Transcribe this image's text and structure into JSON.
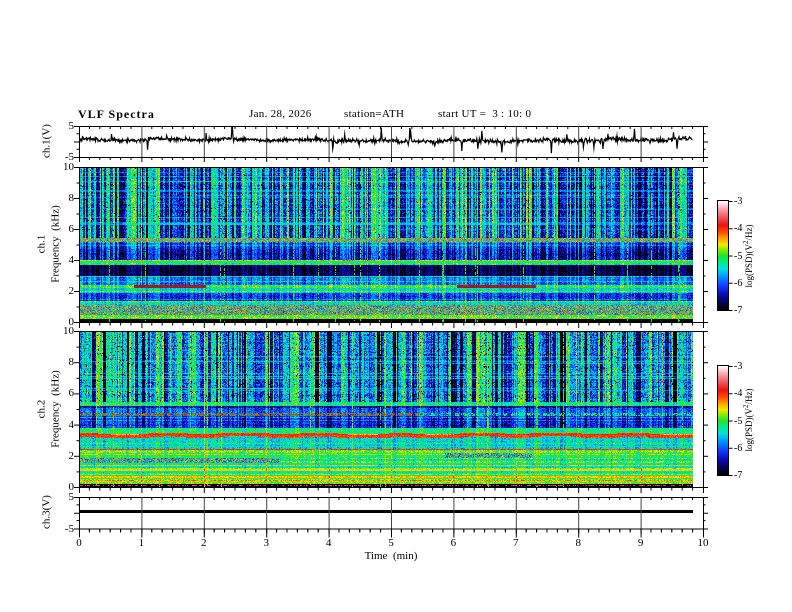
{
  "header": {
    "title": "VLF Spectra",
    "date": "Jan. 28, 2026",
    "station": "station=ATH",
    "start_ut": "start UT =  3 : 10: 0"
  },
  "x_axis": {
    "label": "Time  (min)",
    "range_min": [
      0,
      10
    ],
    "tick_labels": [
      "0",
      "1",
      "2",
      "3",
      "4",
      "5",
      "6",
      "7",
      "8",
      "9",
      "10"
    ],
    "minor_ticks_per_major": 6,
    "data_end_min": 9.82
  },
  "colorbar": {
    "label_prefix": "log(PSD)(V",
    "label_sup": "2",
    "label_suffix": "/Hz)",
    "tick_labels": [
      "-3",
      "-4",
      "-5",
      "-6",
      "-7"
    ],
    "range": [
      -7,
      -3
    ],
    "colormap_stops": [
      [
        0.0,
        0,
        0,
        0
      ],
      [
        0.07,
        5,
        5,
        90
      ],
      [
        0.14,
        10,
        10,
        180
      ],
      [
        0.22,
        20,
        60,
        255
      ],
      [
        0.3,
        0,
        145,
        255
      ],
      [
        0.38,
        0,
        225,
        225
      ],
      [
        0.44,
        0,
        235,
        140
      ],
      [
        0.5,
        40,
        225,
        40
      ],
      [
        0.56,
        150,
        235,
        0
      ],
      [
        0.6,
        248,
        230,
        0
      ],
      [
        0.66,
        255,
        160,
        0
      ],
      [
        0.72,
        255,
        70,
        0
      ],
      [
        0.78,
        232,
        20,
        20
      ],
      [
        0.88,
        245,
        110,
        120
      ],
      [
        0.94,
        250,
        175,
        185
      ],
      [
        1.0,
        255,
        250,
        250
      ]
    ]
  },
  "chart_data": [
    {
      "type": "line",
      "panel": "ch1-voltage",
      "ylabel": "ch.1(V)",
      "ylim": [
        -5,
        5
      ],
      "ytick_labels": [
        "5",
        "-5"
      ],
      "ytick_values": [
        5,
        -5
      ],
      "seed": 101,
      "mean": 0.4,
      "noise_sigma": 0.3,
      "spike_count": 48,
      "spike_max": 3.8
    },
    {
      "type": "heatmap",
      "panel": "ch1-spectrogram",
      "ylabel1": "ch.1",
      "ylabel2": "Frequency  (kHz)",
      "ylim": [
        0,
        10
      ],
      "ytick_labels": [
        "10",
        "8",
        "6",
        "4",
        "2",
        "0"
      ],
      "ytick_values": [
        10,
        8,
        6,
        4,
        2,
        0
      ],
      "clim": [
        -7,
        -3
      ],
      "seed": 7,
      "lam": {
        "fmax": 5.4,
        "p": 0.13,
        "min": 0.25,
        "max": 0.55
      },
      "stripe": {
        "neg": 0.5,
        "pos": 1.3,
        "wmax": 2,
        "p0": 0.22,
        "pneg": 0.3,
        "strong": 18,
        "env": 0.12
      },
      "bands": [
        {
          "lo": 0.0,
          "hi": 0.15,
          "v": -7.0,
          "n": 0.05,
          "sw": 0.0
        },
        {
          "lo": 0.15,
          "hi": 0.45,
          "v": -5.0,
          "n": 0.36,
          "sw": 0.15,
          "hot": 0.06
        },
        {
          "lo": 0.45,
          "hi": 1.05,
          "kind": "uniform",
          "a": -6.4,
          "b": -3.9,
          "sw": 0.0
        },
        {
          "lo": 1.05,
          "hi": 1.3,
          "v": -5.55,
          "n": 0.3,
          "sw": 0.25
        },
        {
          "lo": 1.3,
          "hi": 1.85,
          "v": -6.3,
          "n": 0.3,
          "sw": 0.3
        },
        {
          "lo": 1.85,
          "hi": 2.15,
          "v": -5.55,
          "n": 0.25,
          "sw": 0.25
        },
        {
          "lo": 2.15,
          "hi": 2.4,
          "v": -5.1,
          "n": 0.3,
          "sw": 0.25
        },
        {
          "lo": 2.4,
          "hi": 2.95,
          "v": -6.05,
          "n": 0.3,
          "sw": 0.35
        },
        {
          "lo": 2.95,
          "hi": 3.7,
          "v": -6.85,
          "n": 0.2,
          "sw": 0.28
        },
        {
          "lo": 3.7,
          "hi": 4.0,
          "v": -5.35,
          "n": 0.35,
          "sw": 0.35
        },
        {
          "lo": 4.0,
          "hi": 4.7,
          "v": -6.55,
          "n": 0.3,
          "sw": 0.55
        },
        {
          "lo": 4.7,
          "hi": 5.15,
          "v": -6.3,
          "n": 0.3,
          "sw": 0.55
        },
        {
          "lo": 5.15,
          "hi": 5.4,
          "kind": "uniform",
          "a": -6.1,
          "b": -3.8,
          "sw": 0.0
        },
        {
          "lo": 5.4,
          "hi": 10.01,
          "v": -6.25,
          "n": 0.45,
          "sw": 1.0,
          "rn": 0.15,
          "dk": 0.02
        }
      ],
      "features": [
        {
          "type": "hline",
          "f": 2.28,
          "hw": 0.1,
          "v": -3.9,
          "n": 0.25,
          "t0": 0.88,
          "t1": 2.02,
          "avg": 2,
          "dark": 1
        },
        {
          "type": "hline",
          "f": 2.28,
          "hw": 0.1,
          "v": -3.9,
          "n": 0.25,
          "t0": 6.05,
          "t1": 7.32,
          "avg": 2,
          "dark": 1
        },
        {
          "type": "hline",
          "f": 3.86,
          "hw": 0.08,
          "v": -5.15,
          "n": 0.25,
          "t0": 0,
          "t1": 9.82
        },
        {
          "type": "hlines_random",
          "count": 13,
          "fmin": 5.6,
          "fmax": 9.9,
          "v": -5.5,
          "n": 0.2
        },
        {
          "type": "vlines",
          "count": 22,
          "v": -5.05,
          "mix": 0.7
        },
        {
          "type": "hotpixels",
          "fmin": 9.4,
          "fmax": 10.0,
          "p": 0.002,
          "v": -4.2
        }
      ]
    },
    {
      "type": "heatmap",
      "panel": "ch2-spectrogram",
      "ylabel1": "ch.2",
      "ylabel2": "Frequency  (kHz)",
      "ylim": [
        0,
        10
      ],
      "ytick_labels": [
        "10",
        "8",
        "6",
        "4",
        "2",
        "0"
      ],
      "ytick_values": [
        10,
        8,
        6,
        4,
        2,
        0
      ],
      "clim": [
        -7,
        -3
      ],
      "seed": 23,
      "lam": {
        "fmax": 4.55,
        "p": 0.22,
        "min": 0.3,
        "max": 0.85
      },
      "stripe": {
        "neg": 1.45,
        "pos": 0.55,
        "wmax": 4,
        "p0": 0.22,
        "pneg": 0.6,
        "strong": 10,
        "env": 0.1
      },
      "bands": [
        {
          "lo": 0.0,
          "hi": 0.15,
          "v": -7.0,
          "n": 0.05,
          "sw": 0.0
        },
        {
          "lo": 0.15,
          "hi": 0.5,
          "v": -4.8,
          "n": 0.32,
          "sw": 0.1,
          "hot": 0.03
        },
        {
          "lo": 0.5,
          "hi": 0.9,
          "v": -5.1,
          "n": 0.3,
          "sw": 0.12
        },
        {
          "lo": 0.9,
          "hi": 1.5,
          "v": -5.35,
          "n": 0.28,
          "sw": 0.15
        },
        {
          "lo": 1.5,
          "hi": 1.85,
          "v": -5.35,
          "n": 0.28,
          "sw": 0.15
        },
        {
          "lo": 1.85,
          "hi": 2.15,
          "v": -5.1,
          "n": 0.3,
          "sw": 0.15
        },
        {
          "lo": 2.15,
          "hi": 2.45,
          "v": -4.75,
          "n": 0.28,
          "sw": 0.15
        },
        {
          "lo": 2.45,
          "hi": 3.15,
          "v": -5.45,
          "n": 0.32,
          "sw": 0.2
        },
        {
          "lo": 3.15,
          "hi": 3.42,
          "v": -4.0,
          "n": 0.18,
          "sw": 0.0,
          "wavy": 1
        },
        {
          "lo": 3.42,
          "hi": 3.75,
          "v": -5.15,
          "n": 0.28,
          "sw": 0.2
        },
        {
          "lo": 3.75,
          "hi": 4.55,
          "v": -6.15,
          "n": 0.32,
          "sw": 0.45
        },
        {
          "lo": 4.55,
          "hi": 5.05,
          "v": -5.9,
          "n": 0.32,
          "sw": 0.4
        },
        {
          "lo": 5.05,
          "hi": 5.2,
          "v": -6.45,
          "n": 0.35,
          "sw": 0.25
        },
        {
          "lo": 5.2,
          "hi": 5.45,
          "v": -5.15,
          "n": 0.28,
          "sw": 0.3
        },
        {
          "lo": 5.45,
          "hi": 10.01,
          "v": -5.6,
          "n": 0.48,
          "sw": 1.0,
          "rn": 0.14,
          "dk": 0.05
        }
      ],
      "features": [
        {
          "type": "grayseg",
          "f0": 1.5,
          "f1": 1.85,
          "t0": 0,
          "t1": 3.2,
          "a": -6.6,
          "b": -4.1
        },
        {
          "type": "grayseg",
          "f0": 1.85,
          "f1": 2.15,
          "t0": 5.85,
          "t1": 7.25,
          "a": -6.6,
          "b": -4.3
        },
        {
          "type": "hline",
          "f": 0.62,
          "hw": 0.07,
          "v": -4.45,
          "n": 0.2,
          "t0": 0,
          "t1": 9.82
        },
        {
          "type": "hline",
          "f": 1.05,
          "hw": 0.06,
          "v": -4.6,
          "n": 0.2,
          "t0": 0,
          "t1": 9.82
        },
        {
          "type": "dotline",
          "f": 4.65,
          "hw": 0.09,
          "v": -4.35,
          "n": 0.3,
          "t0": 0,
          "t1": 5.5,
          "duty": 0.55,
          "avg": 2,
          "dark": 1
        },
        {
          "type": "dotline",
          "f": 4.65,
          "hw": 0.07,
          "v": -5.1,
          "n": 0.3,
          "t0": 5.5,
          "t1": 9.82,
          "duty": 0.35
        },
        {
          "type": "dotline",
          "f": 0.06,
          "hw": 0.05,
          "v": -4.05,
          "n": 0.2,
          "t0": 0,
          "t1": 9.82,
          "duty": 0.45
        },
        {
          "type": "hlines_random",
          "count": 9,
          "fmin": 5.6,
          "fmax": 9.9,
          "v": -5.3,
          "n": 0.2
        },
        {
          "type": "vlines",
          "count": 20,
          "v": -4.9,
          "mix": 0.75
        },
        {
          "type": "hotpixels",
          "fmin": 9.3,
          "fmax": 10.0,
          "p": 0.004,
          "v": -4.0
        }
      ]
    },
    {
      "type": "line",
      "panel": "ch3-voltage",
      "ylabel": "ch.3(V)",
      "ylim": [
        -5,
        5
      ],
      "ytick_labels": [
        "5",
        "-5"
      ],
      "ytick_values": [
        5,
        -5
      ],
      "constant_value": 0.5,
      "line_thickness_px": 3.4
    }
  ]
}
